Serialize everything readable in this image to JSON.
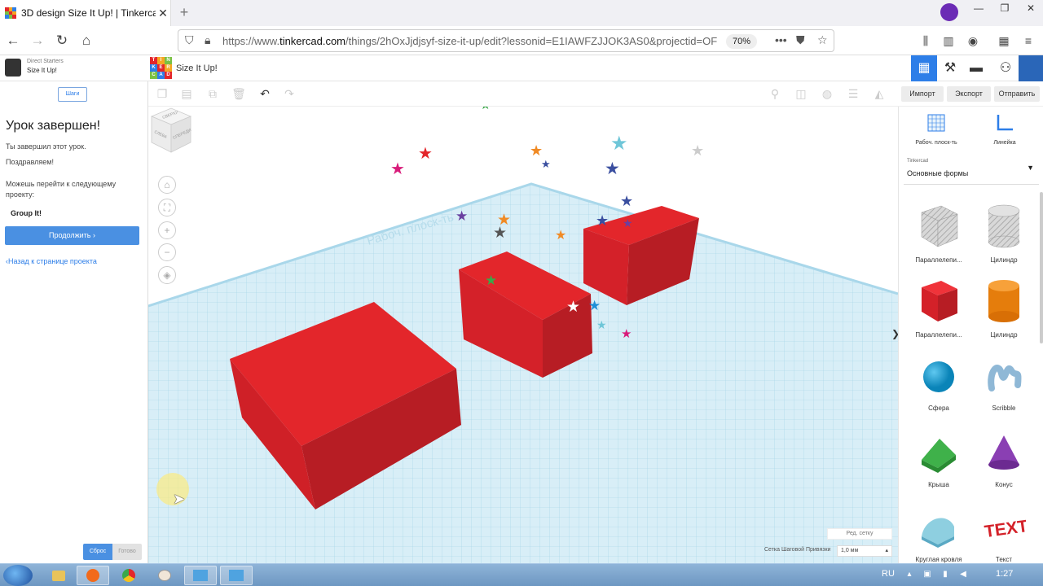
{
  "browser": {
    "tab_title": "3D design Size It Up! | Tinkercad",
    "url_prefix": "https://www.",
    "url_domain": "tinkercad.com",
    "url_rest": "/things/2hOxJjdjsyf-size-it-up/edit?lessonid=E1IAWFZJJOK3AS0&projectid=OF",
    "zoom": "70%"
  },
  "header": {
    "project_group": "Direct Starters",
    "project_name": "Size It Up!",
    "design_title": "Size It Up!",
    "logo_letters": [
      "T",
      "I",
      "N",
      "K",
      "E",
      "R",
      "C",
      "A",
      "D"
    ]
  },
  "lesson": {
    "steps_button": "Шаги",
    "heading": "Урок завершен!",
    "line1": "Ты завершил этот урок.",
    "line2": "Поздравляем!",
    "line3": "Можешь перейти к следующему проекту:",
    "next_project": "Group It!",
    "continue_button": "Продолжить",
    "back_link": "Назад к странице проекта",
    "reset_button": "Сброс",
    "done_button": "Готово"
  },
  "actions": {
    "import": "Импорт",
    "export": "Экспорт",
    "send": "Отправить"
  },
  "right_panel": {
    "tool_workplane": "Рабоч. плоск-ть",
    "tool_ruler": "Линейка",
    "library_source": "Tinkercad",
    "library_name": "Основные формы",
    "shapes": [
      {
        "name": "Параллелепи...",
        "icon": "box-hole-icon"
      },
      {
        "name": "Цилиндр",
        "icon": "cylinder-hole-icon"
      },
      {
        "name": "Параллелепи...",
        "icon": "box-icon"
      },
      {
        "name": "Цилиндр",
        "icon": "cylinder-icon"
      },
      {
        "name": "Сфера",
        "icon": "sphere-icon"
      },
      {
        "name": "Scribble",
        "icon": "scribble-icon"
      },
      {
        "name": "Крыша",
        "icon": "roof-icon"
      },
      {
        "name": "Конус",
        "icon": "cone-icon"
      },
      {
        "name": "Круглая кровля",
        "icon": "round-roof-icon"
      },
      {
        "name": "Текст",
        "icon": "text-icon"
      }
    ]
  },
  "workspace": {
    "edit_grid": "Ред. сетку",
    "snap_label": "Сетка Шаговой Привязки",
    "snap_value": "1,0 мм",
    "viewcube_front": "СПЕРЕДИ",
    "viewcube_top": "СВЕРХУ",
    "viewcube_side": "СЛЕВА",
    "workplane_watermark": "Рабоч. плоск-ть"
  },
  "taskbar": {
    "language": "RU",
    "time": "1:27"
  },
  "colors": {
    "accent": "#2d7ee8",
    "box_red": "#e3262b",
    "grid_blue": "#cbe6f2"
  }
}
